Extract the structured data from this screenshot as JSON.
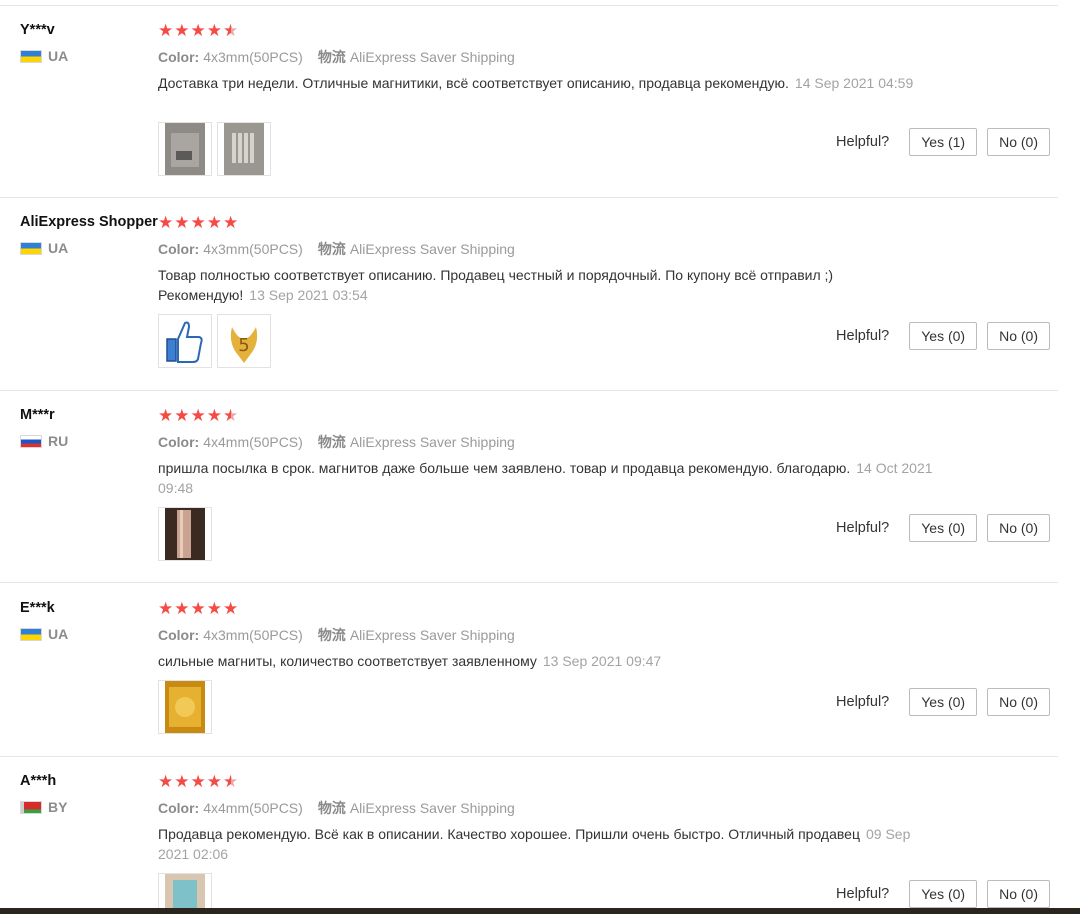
{
  "labels": {
    "color": "Color:",
    "shipping": "物流",
    "helpful": "Helpful?"
  },
  "reviews": [
    {
      "user": "Y***v",
      "country": "UA",
      "rating": 4.5,
      "color_value": "4x3mm(50PCS)",
      "shipping_value": "AliExpress Saver Shipping",
      "text": "Доставка три недели. Отличные магнитики, всё соответствует описанию, продавца рекомендую.",
      "date": "14 Sep 2021 04:59",
      "yes": "Yes (1)",
      "no": "No (0)"
    },
    {
      "user": "AliExpress Shopper",
      "country": "UA",
      "rating": 5,
      "color_value": "4x3mm(50PCS)",
      "shipping_value": "AliExpress Saver Shipping",
      "text": "Товар полностью соответствует описанию. Продавец честный и порядочный. По купону всё отправил ;) Рекомендую!",
      "date": "13 Sep 2021 03:54",
      "yes": "Yes (0)",
      "no": "No (0)"
    },
    {
      "user": "M***r",
      "country": "RU",
      "rating": 4.5,
      "color_value": "4x4mm(50PCS)",
      "shipping_value": "AliExpress Saver Shipping",
      "text": "пришла посылка в срок. магнитов даже больше чем заявлено. товар и продавца рекомендую. благодарю.",
      "date": "14 Oct 2021 09:48",
      "yes": "Yes (0)",
      "no": "No (0)"
    },
    {
      "user": "E***k",
      "country": "UA",
      "rating": 5,
      "color_value": "4x3mm(50PCS)",
      "shipping_value": "AliExpress Saver Shipping",
      "text": "сильные магниты, количество соответствует заявленному",
      "date": "13 Sep 2021 09:47",
      "yes": "Yes (0)",
      "no": "No (0)"
    },
    {
      "user": "A***h",
      "country": "BY",
      "rating": 4.5,
      "color_value": "4x4mm(50PCS)",
      "shipping_value": "AliExpress Saver Shipping",
      "text": "Продавца рекомендую. Всё как в описании. Качество хорошее. Пришли очень быстро. Отличный продавец",
      "date": "09 Sep 2021 02:06",
      "yes": "Yes (0)",
      "no": "No (0)"
    }
  ],
  "colors": {
    "star": "#f44b47",
    "muted": "#9a9a9a",
    "divider": "#e6e6e6"
  }
}
